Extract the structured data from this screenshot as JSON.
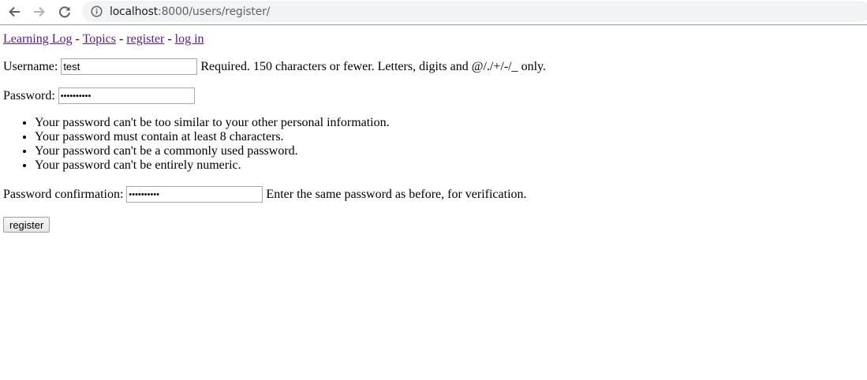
{
  "browser": {
    "url_host": "localhost",
    "url_path": ":8000/users/register/",
    "icons": {
      "back": "back-arrow-icon",
      "forward": "forward-arrow-icon",
      "reload": "reload-icon",
      "info": "info-icon"
    }
  },
  "nav": {
    "links": [
      "Learning Log",
      "Topics",
      "register",
      "log in"
    ],
    "separator": "-"
  },
  "form": {
    "username_label": "Username:",
    "username_value": "test",
    "username_help": "Required. 150 characters or fewer. Letters, digits and @/./+/-/_ only.",
    "password_label": "Password:",
    "password_value": "••••••••••",
    "password_help": [
      "Your password can't be too similar to your other personal information.",
      "Your password must contain at least 8 characters.",
      "Your password can't be a commonly used password.",
      "Your password can't be entirely numeric."
    ],
    "confirm_label": "Password confirmation:",
    "confirm_value": "••••••••••",
    "confirm_help": "Enter the same password as before, for verification.",
    "submit_label": "register"
  },
  "colors": {
    "link": "#551a8b",
    "omnibox_bg": "#f1f3f4"
  }
}
